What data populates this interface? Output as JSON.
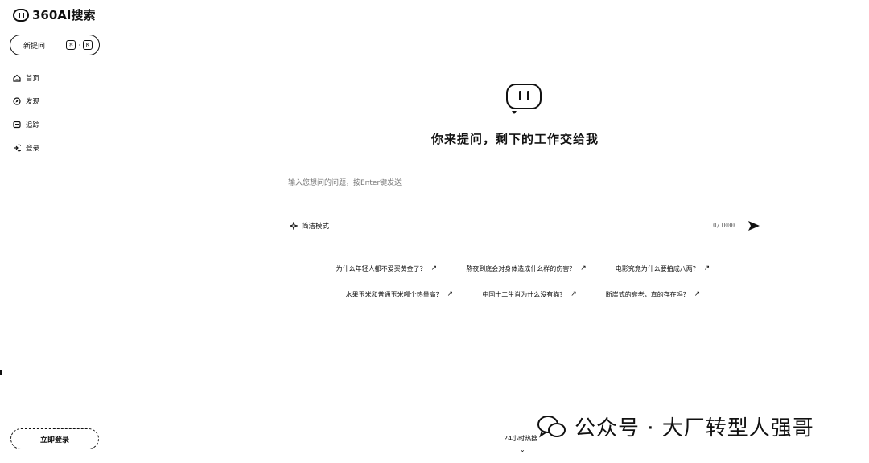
{
  "app": {
    "logo_text": "360AI搜索"
  },
  "sidebar": {
    "new_question": {
      "label": "新提问",
      "keys": [
        "⌘",
        "K"
      ],
      "separator": "·"
    },
    "nav": [
      {
        "label": "首页",
        "icon": "home-icon"
      },
      {
        "label": "发现",
        "icon": "compass-icon"
      },
      {
        "label": "追踪",
        "icon": "bookmark-icon"
      },
      {
        "label": "登录",
        "icon": "login-icon"
      }
    ],
    "login_button": "立即登录"
  },
  "main": {
    "headline": "你来提问，剩下的工作交给我",
    "search": {
      "placeholder": "输入您想问的问题，按Enter键发送",
      "value": ""
    },
    "mode_label": "简洁模式",
    "char_count": "0/1000",
    "suggestions": [
      [
        "为什么年轻人都不爱买黄金了？",
        "熬夜到底会对身体造成什么样的伤害？",
        "电影究竟为什么要拍成八两？"
      ],
      [
        "水果玉米和普通玉米哪个热量高？",
        "中国十二生肖为什么没有猫？",
        "断崖式的衰老，真的存在吗？"
      ]
    ],
    "hot_label": "24小时热搜",
    "hot_chevron": "⌄"
  },
  "watermark": {
    "text": "公众号 · 大厂转型人强哥"
  }
}
